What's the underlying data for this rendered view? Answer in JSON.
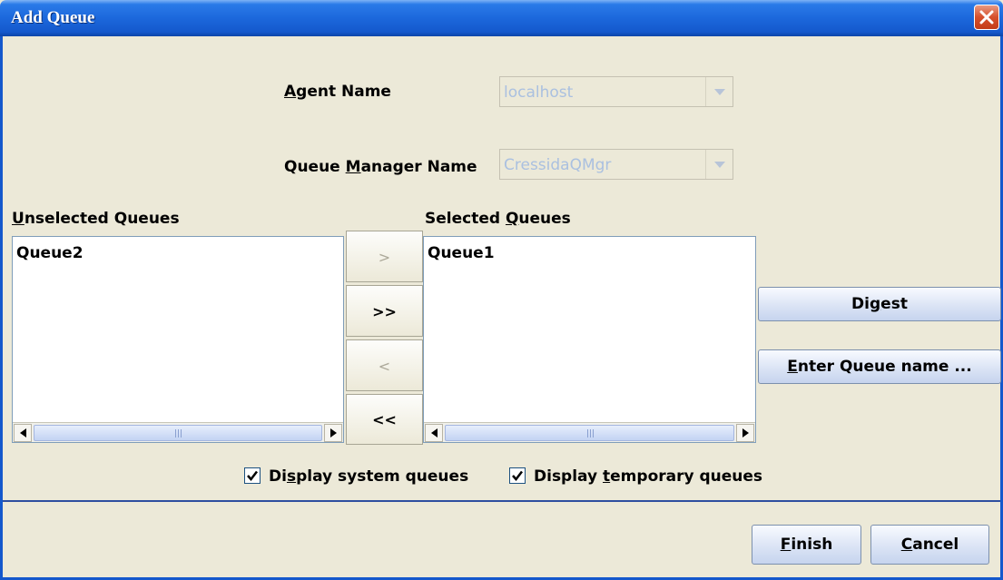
{
  "window": {
    "title": "Add Queue"
  },
  "agent": {
    "label": "Agent Name",
    "value": "localhost"
  },
  "queue_manager": {
    "label": "Queue Manager Name",
    "value": "CressidaQMgr"
  },
  "unselected": {
    "label": "Unselected Queues",
    "items": [
      "Queue2"
    ]
  },
  "selected": {
    "label": "Selected Queues",
    "items": [
      "Queue1"
    ]
  },
  "transfer_buttons": {
    "move_one_right": ">",
    "move_all_right": ">>",
    "move_one_left": "<",
    "move_all_left": "<<"
  },
  "side_buttons": {
    "digest": "Digest",
    "enter_queue_name": "Enter Queue name ..."
  },
  "options": {
    "system_queues": {
      "label": "Display system queues",
      "checked": true
    },
    "temporary_queues": {
      "label": "Display temporary queues",
      "checked": true
    }
  },
  "footer": {
    "finish": "Finish",
    "cancel": "Cancel"
  }
}
